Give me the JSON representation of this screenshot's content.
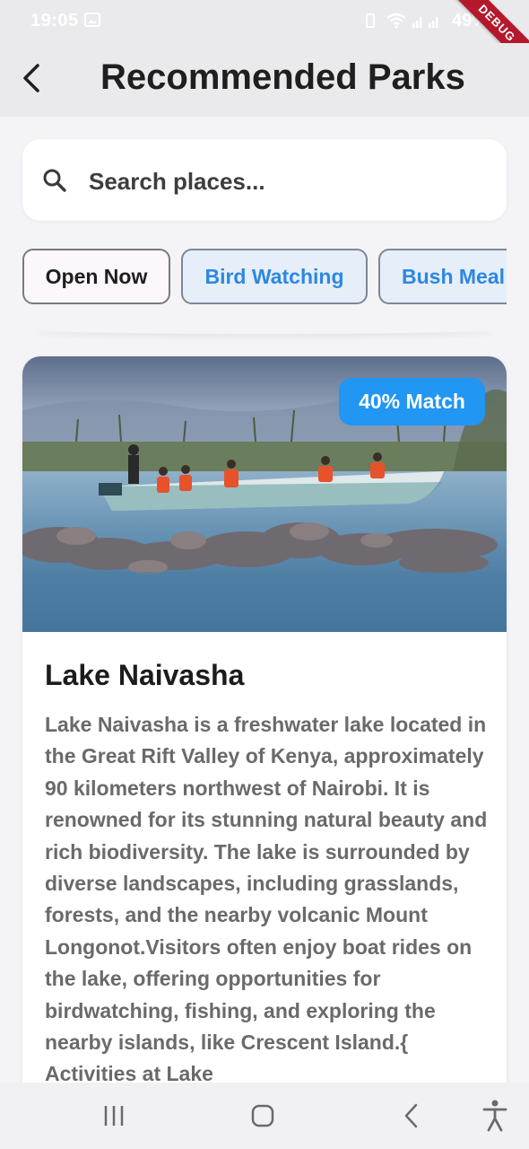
{
  "status_bar": {
    "time": "19:05",
    "battery": "49%",
    "debug_label": "DEBUG"
  },
  "header": {
    "title": "Recommended Parks"
  },
  "search": {
    "placeholder": "Search places..."
  },
  "filters": [
    {
      "label": "Open Now",
      "selected": false
    },
    {
      "label": "Bird Watching",
      "selected": true
    },
    {
      "label": "Bush Meal",
      "selected": true
    }
  ],
  "park": {
    "match": "40% Match",
    "name": "Lake Naivasha",
    "description": "Lake Naivasha is a freshwater lake located in the Great Rift Valley of Kenya, approximately 90 kilometers northwest of Nairobi. It is renowned for its stunning natural beauty and rich biodiversity. The lake is surrounded by diverse landscapes, including grasslands, forests, and the nearby volcanic Mount Longonot.Visitors often enjoy boat rides on the lake, offering opportunities for birdwatching, fishing, and exploring the nearby islands, like Crescent Island.{ Activities at Lake"
  },
  "colors": {
    "accent": "#2196f3",
    "chip_text": "#2c88e0"
  },
  "icons": {
    "back": "back-arrow-icon",
    "search": "search-icon",
    "nav": [
      "recent-apps-icon",
      "home-icon",
      "back-icon",
      "accessibility-icon"
    ]
  }
}
